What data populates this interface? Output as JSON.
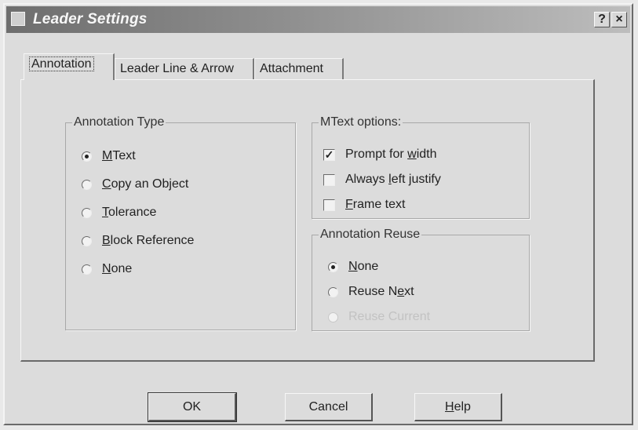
{
  "window": {
    "title": "Leader Settings",
    "help_btn": "?",
    "close_btn": "×"
  },
  "tabs": [
    {
      "label": "Annotation",
      "active": true
    },
    {
      "label": "Leader Line & Arrow",
      "active": false
    },
    {
      "label": "Attachment",
      "active": false
    }
  ],
  "annotation_type": {
    "legend": "Annotation Type",
    "options": [
      {
        "pre": "",
        "key": "M",
        "post": "Text",
        "checked": true
      },
      {
        "pre": "",
        "key": "C",
        "post": "opy an Object",
        "checked": false
      },
      {
        "pre": "",
        "key": "T",
        "post": "olerance",
        "checked": false
      },
      {
        "pre": "",
        "key": "B",
        "post": "lock Reference",
        "checked": false
      },
      {
        "pre": "",
        "key": "N",
        "post": "one",
        "checked": false
      }
    ]
  },
  "mtext_options": {
    "legend": "MText options:",
    "options": [
      {
        "pre": "Prompt for ",
        "key": "w",
        "post": "idth",
        "checked": true
      },
      {
        "pre": "Always ",
        "key": "l",
        "post": "eft justify",
        "checked": false
      },
      {
        "pre": "",
        "key": "F",
        "post": "rame text",
        "checked": false
      }
    ]
  },
  "annotation_reuse": {
    "legend": "Annotation Reuse",
    "options": [
      {
        "pre": "",
        "key": "N",
        "post": "one",
        "checked": true
      },
      {
        "pre": "Reuse N",
        "key": "e",
        "post": "xt",
        "checked": false
      },
      {
        "pre": "Reuse Current",
        "key": "",
        "post": "",
        "checked": false,
        "disabled": true
      }
    ]
  },
  "buttons": {
    "ok": "OK",
    "cancel": "Cancel",
    "help_pre": "",
    "help_key": "H",
    "help_post": "elp"
  }
}
